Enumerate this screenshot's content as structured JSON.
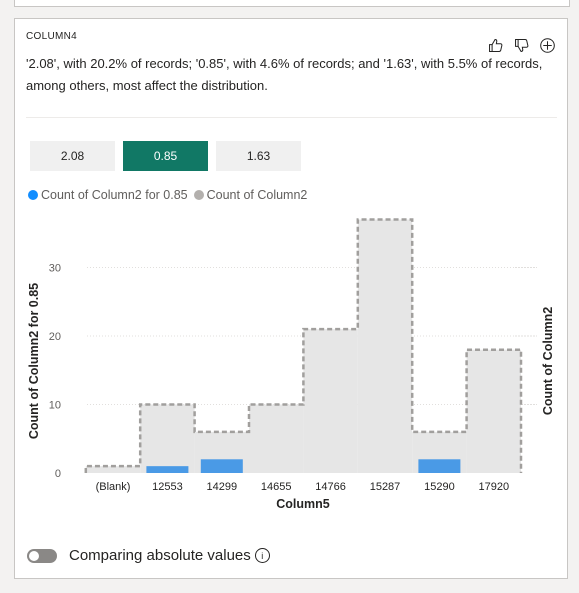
{
  "card": {
    "title": "COLUMN4",
    "description": "'2.08', with 20.2% of records; '0.85', with 4.6% of records; and '1.63', with 5.5% of records, among others, most affect the distribution.",
    "icons": [
      "thumbs-up-icon",
      "thumbs-down-icon",
      "add-circle-icon"
    ]
  },
  "segments": [
    {
      "label": "2.08",
      "selected": false
    },
    {
      "label": "0.85",
      "selected": true
    },
    {
      "label": "1.63",
      "selected": false
    }
  ],
  "legend": [
    {
      "label": "Count of Column2 for 0.85",
      "color": "#118dff"
    },
    {
      "label": "Count of Column2",
      "color": "#b3b0ad"
    }
  ],
  "chart_data": {
    "type": "bar",
    "categories": [
      "(Blank)",
      "12553",
      "14299",
      "14655",
      "14766",
      "15287",
      "15290",
      "17920"
    ],
    "series": [
      {
        "name": "Count of Column2 for 0.85",
        "values": [
          0,
          1,
          2,
          0,
          0,
          0,
          2,
          0
        ],
        "color": "#4a9ae6"
      },
      {
        "name": "Count of Column2",
        "values": [
          1,
          10,
          6,
          10,
          21,
          37,
          6,
          18
        ],
        "color": "#e6e6e6"
      }
    ],
    "xlabel": "Column5",
    "ylabel": "Count of Column2 for 0.85",
    "ylabel_right": "Count of Column2",
    "yticks": [
      0,
      10,
      20,
      30
    ],
    "ylim": [
      0,
      37
    ],
    "grid": true
  },
  "toggle": {
    "label": "Comparing absolute values",
    "on": false,
    "info_glyph": "i"
  }
}
